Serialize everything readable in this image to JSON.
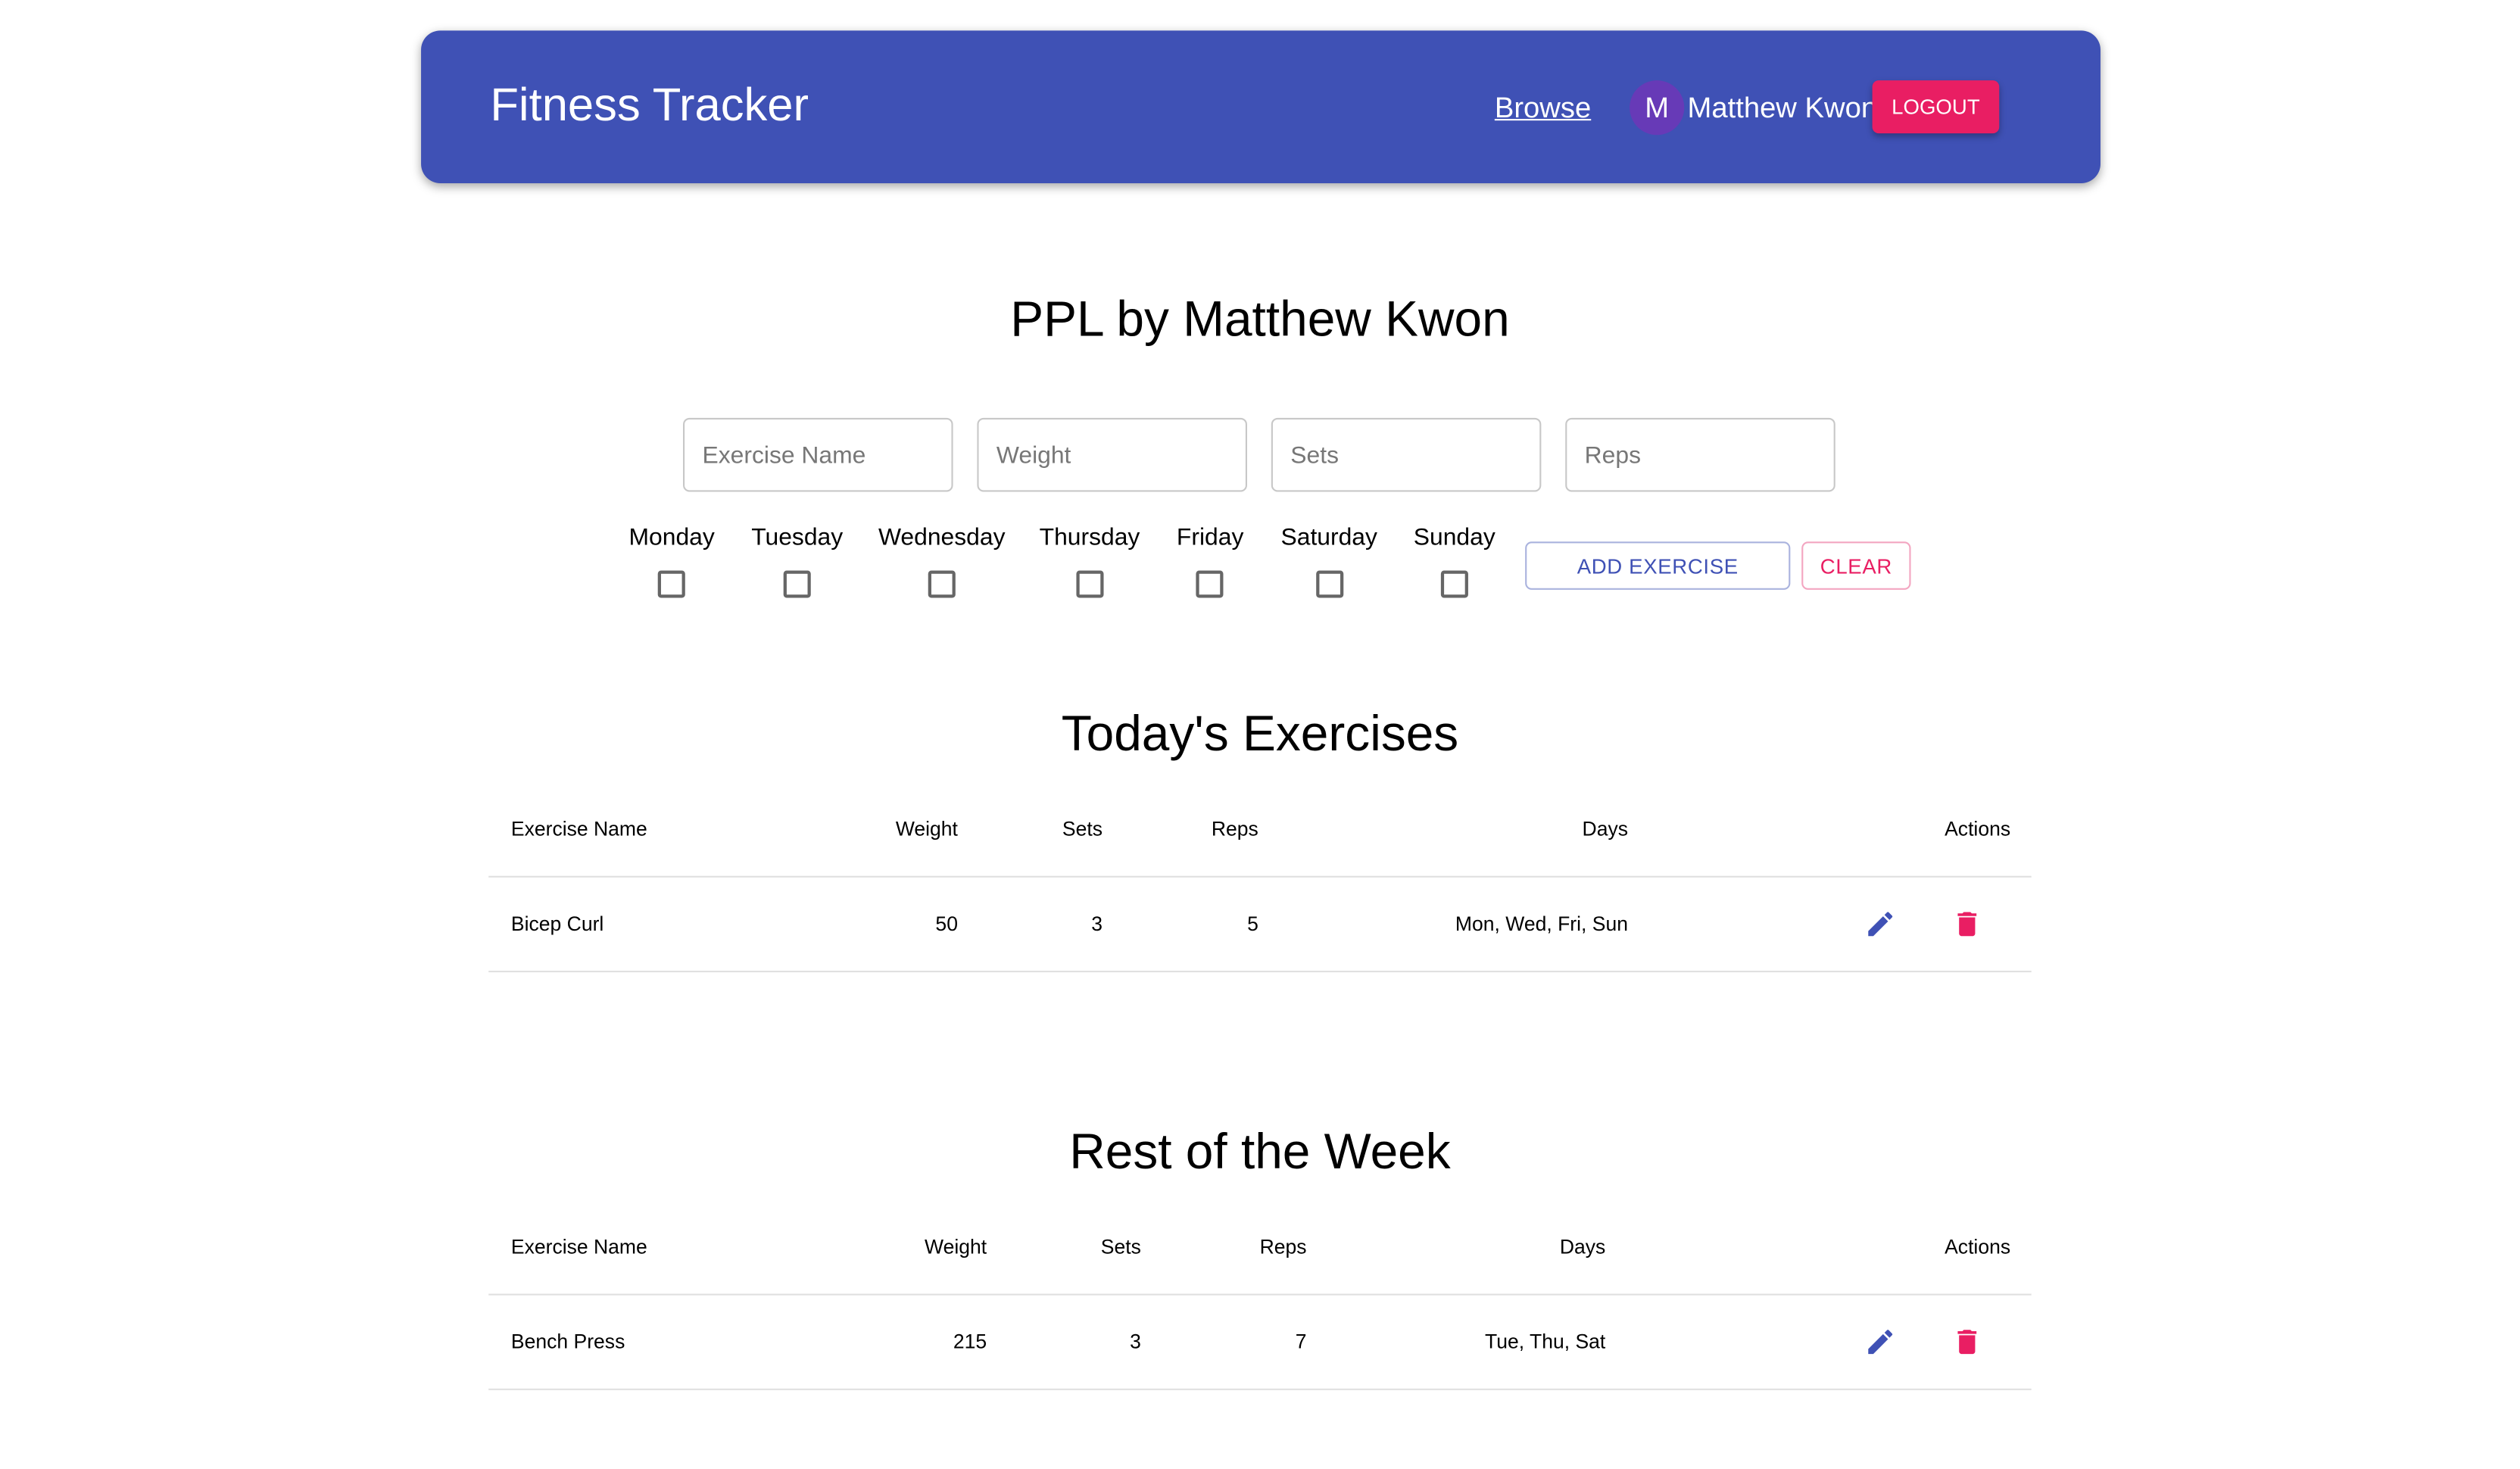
{
  "header": {
    "app_title": "Fitness Tracker",
    "browse_link": "Browse",
    "avatar_initial": "M",
    "username": "Matthew Kwon",
    "logout_label": "LOGOUT"
  },
  "routine_title": "PPL by Matthew Kwon",
  "form": {
    "exercise_name_placeholder": "Exercise Name",
    "weight_placeholder": "Weight",
    "sets_placeholder": "Sets",
    "reps_placeholder": "Reps",
    "days": [
      "Monday",
      "Tuesday",
      "Wednesday",
      "Thursday",
      "Friday",
      "Saturday",
      "Sunday"
    ],
    "add_label": "ADD EXERCISE",
    "clear_label": "CLEAR"
  },
  "today": {
    "title": "Today's Exercises",
    "headers": [
      "Exercise Name",
      "Weight",
      "Sets",
      "Reps",
      "Days",
      "Actions"
    ],
    "rows": [
      {
        "name": "Bicep Curl",
        "weight": "50",
        "sets": "3",
        "reps": "5",
        "days": "Mon, Wed, Fri, Sun"
      }
    ]
  },
  "rest": {
    "title": "Rest of the Week",
    "headers": [
      "Exercise Name",
      "Weight",
      "Sets",
      "Reps",
      "Days",
      "Actions"
    ],
    "rows": [
      {
        "name": "Bench Press",
        "weight": "215",
        "sets": "3",
        "reps": "7",
        "days": "Tue, Thu, Sat"
      }
    ]
  },
  "colors": {
    "primary": "#3f51b5",
    "secondary": "#e91e63",
    "avatar": "#673ab7"
  },
  "icons": {
    "edit": "pencil-icon",
    "delete": "trash-icon"
  }
}
